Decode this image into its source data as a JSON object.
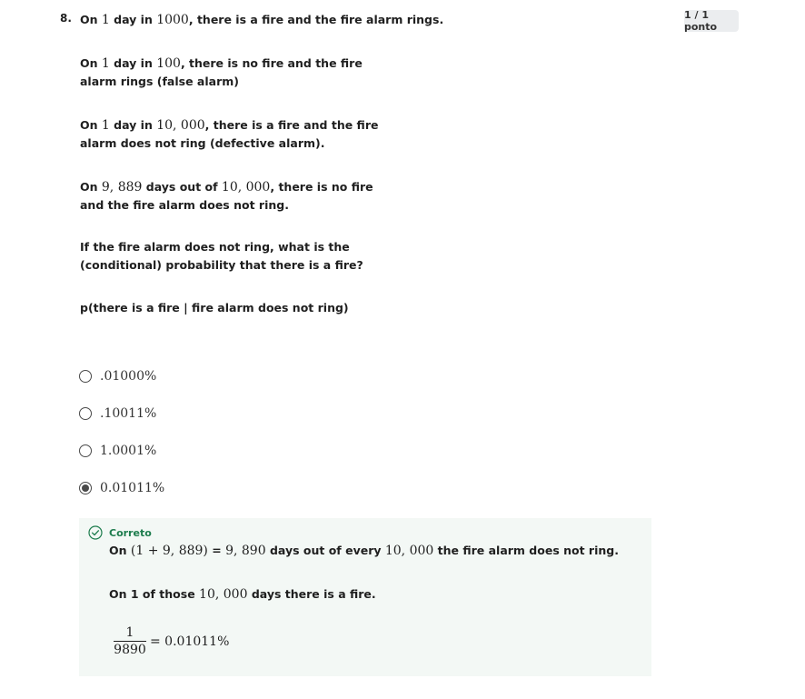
{
  "question": {
    "number": "8.",
    "score": "1 / 1 ponto",
    "prompt": {
      "p1": [
        {
          "t": "On ",
          "math": false
        },
        {
          "t": "1",
          "math": true
        },
        {
          "t": " day in ",
          "math": false
        },
        {
          "t": "1000",
          "math": true
        },
        {
          "t": ", there is a fire and the fire alarm rings.",
          "math": false
        }
      ],
      "p2": [
        {
          "t": "On ",
          "math": false
        },
        {
          "t": "1",
          "math": true
        },
        {
          "t": " day in ",
          "math": false
        },
        {
          "t": "100",
          "math": true
        },
        {
          "t": ", there is no fire and the fire alarm rings (false alarm)",
          "math": false
        }
      ],
      "p3": [
        {
          "t": "On ",
          "math": false
        },
        {
          "t": "1",
          "math": true
        },
        {
          "t": " day in ",
          "math": false
        },
        {
          "t": "10, 000",
          "math": true
        },
        {
          "t": ", there is a fire and the fire alarm does not ring (defective alarm).",
          "math": false
        }
      ],
      "p4": [
        {
          "t": "On ",
          "math": false
        },
        {
          "t": "9, 889",
          "math": true
        },
        {
          "t": " days out of ",
          "math": false
        },
        {
          "t": "10, 000",
          "math": true
        },
        {
          "t": ", there is no fire and the fire alarm does not ring.",
          "math": false
        }
      ],
      "p5": [
        {
          "t": "If the fire alarm does not ring, what is the (conditional) probability that there is a fire?",
          "math": false
        }
      ],
      "p6": [
        {
          "t": "p(there is a fire | fire alarm does not ring)",
          "math": false
        }
      ]
    },
    "options": [
      {
        "label": ".01000%",
        "selected": false
      },
      {
        "label": ".10011%",
        "selected": false
      },
      {
        "label": "1.0001%",
        "selected": false
      },
      {
        "label": "0.01011%",
        "selected": true
      }
    ],
    "feedback": {
      "status": "Correto",
      "color": "#1d7c4d",
      "line1": [
        {
          "t": "On ",
          "math": false
        },
        {
          "t": "(1 + 9, 889)",
          "math": true
        },
        {
          "t": " = ",
          "math": false
        },
        {
          "t": "9, 890",
          "math": true
        },
        {
          "t": " days out of every ",
          "math": false
        },
        {
          "t": "10, 000",
          "math": true
        },
        {
          "t": " the fire alarm does not ring.",
          "math": false
        }
      ],
      "line2": [
        {
          "t": "On 1 of those ",
          "math": false
        },
        {
          "t": "10, 000",
          "math": true
        },
        {
          "t": " days there is a fire.",
          "math": false
        }
      ],
      "fraction": {
        "numerator": "1",
        "denominator": "9890",
        "result": "= 0.01011%"
      }
    }
  }
}
